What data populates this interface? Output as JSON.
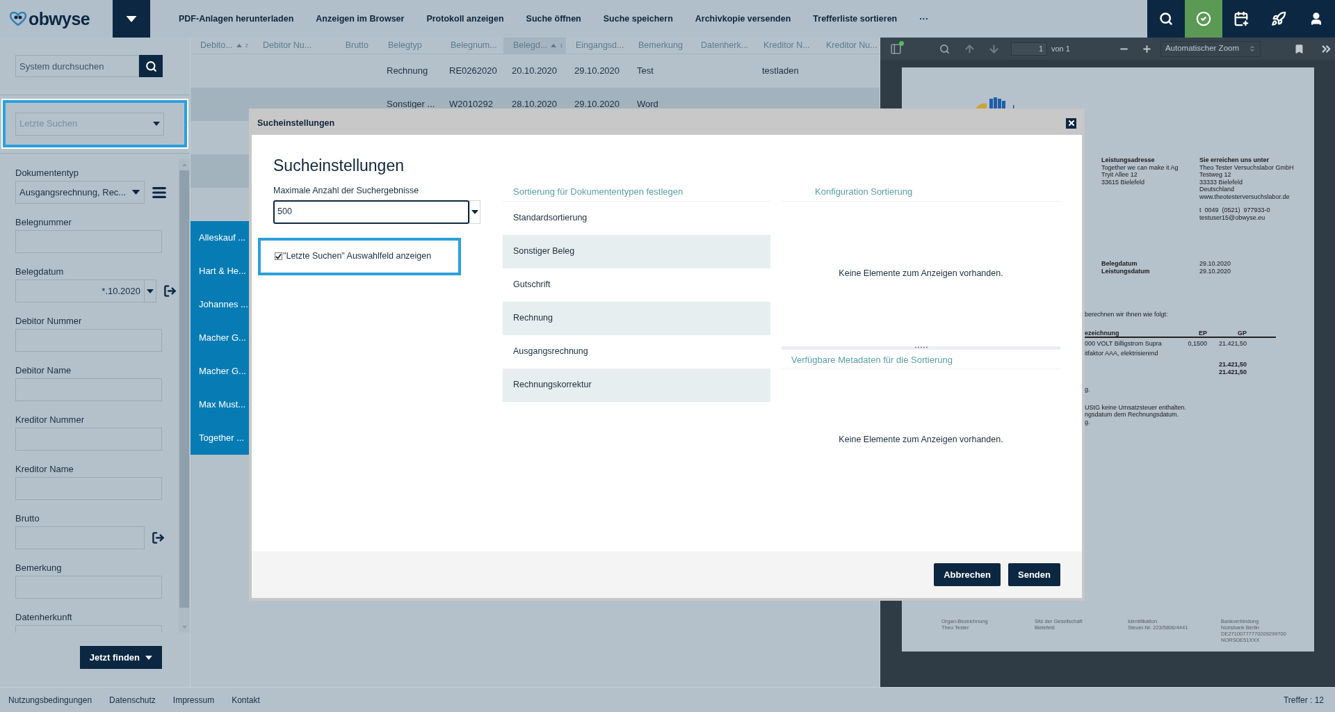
{
  "app": {
    "logo": "obwyse"
  },
  "toolbar": {
    "actions": [
      "PDF-Anlagen herunterladen",
      "Anzeigen im Browser",
      "Protokoll anzeigen",
      "Suche öffnen",
      "Suche speichern",
      "Archivkopie versenden",
      "Trefferliste sortieren"
    ],
    "more": "···"
  },
  "sidebar": {
    "search": {
      "placeholder": "System durchsuchen"
    },
    "recent": {
      "placeholder": "Letzte Suchen"
    },
    "fields": [
      {
        "label": "Dokumententyp",
        "kind": "select",
        "value": "Ausgangsrechnung, Rec..."
      },
      {
        "label": "Belegnummer",
        "kind": "text"
      },
      {
        "label": "Belegdatum",
        "kind": "date",
        "value": "*.10.2020"
      },
      {
        "label": "Debitor Nummer",
        "kind": "text"
      },
      {
        "label": "Debitor Name",
        "kind": "text"
      },
      {
        "label": "Kreditor Nummer",
        "kind": "text"
      },
      {
        "label": "Kreditor Name",
        "kind": "text"
      },
      {
        "label": "Brutto",
        "kind": "range"
      },
      {
        "label": "Bemerkung",
        "kind": "text"
      },
      {
        "label": "Datenherkunft",
        "kind": "text"
      }
    ],
    "submit": "Jetzt finden"
  },
  "table": {
    "columns": [
      {
        "label": "Debito...",
        "sort_order": "2",
        "active": false
      },
      {
        "label": "Debitor Nu...",
        "active": false
      },
      {
        "label": "Brutto",
        "active": false
      },
      {
        "label": "Belegtyp",
        "active": false
      },
      {
        "label": "Belegnum...",
        "active": false
      },
      {
        "label": "Belegd...",
        "sort_order": "1",
        "active": true
      },
      {
        "label": "Eingangsd...",
        "active": false
      },
      {
        "label": "Bemerkung",
        "active": false
      },
      {
        "label": "Datenherk...",
        "active": false
      },
      {
        "label": "Kreditor N...",
        "active": false
      },
      {
        "label": "Kreditor Nu...",
        "active": false
      }
    ],
    "rows": [
      {
        "belegtyp": "Rechnung",
        "belegnummer": "RE0262020",
        "belegdatum": "20.10.2020",
        "eingangsdatum": "29.10.2020",
        "bemerkung": "Test",
        "kreditor_name": "testladen"
      },
      {
        "belegtyp": "Sonstiger ...",
        "belegnummer": "W2010292",
        "belegdatum": "28.10.2020",
        "eingangsdatum": "29.10.2020",
        "bemerkung": "Word"
      },
      {},
      {},
      {},
      {
        "debitor": "Alleskauf ..."
      },
      {
        "debitor": "Hart & He..."
      },
      {
        "debitor": "Johannes ..."
      },
      {
        "debitor": "Macher G..."
      },
      {
        "debitor": "Macher G..."
      },
      {
        "debitor": "Max Must..."
      },
      {
        "debitor": "Together ..."
      }
    ]
  },
  "pdf_viewer": {
    "page_input": "1",
    "page_total": "von 1",
    "zoom": "Automatischer Zoom",
    "document": {
      "address_blocks": [
        {
          "heading": "Leistungsadresse",
          "lines": [
            "Together we can make it Ag",
            "Tryit Allee 12",
            "33615 Bielefeld"
          ]
        },
        {
          "heading": "Sie erreichen uns unter",
          "lines": [
            "Theo Tester Versuchslabor GmbH",
            "Testweg 12",
            "33333 Bielefeld",
            "Deutschland",
            "www.theotesterversuchslabor.de"
          ],
          "contact": [
            "t  0049  (0521)  977933-0",
            "testuser15@obwyse.eu"
          ]
        }
      ],
      "dates": [
        {
          "label": "Belegdatum",
          "value": "29.10.2020"
        },
        {
          "label": "Leistungsdatum",
          "value": "29.10.2020"
        }
      ],
      "intro": "berechnen wir Ihnen wie folgt:",
      "items": {
        "columns": [
          "ezeichnung",
          "EP",
          "GP"
        ],
        "rows": [
          [
            "000 VOLT Billigstrom Supra",
            "0,1500",
            "21.421,50"
          ],
          [
            "itfaktor AAA, elektrisierend"
          ]
        ],
        "totals": [
          "21.421,50",
          "21.421,50"
        ]
      },
      "notes": [
        [
          "g."
        ],
        [
          "UStG keine Umsatzsteuer enthalten.",
          "ngsdatum dem Rechnungsdatum.",
          "g."
        ]
      ],
      "footer": [
        [
          "Organ-Bezeichnung",
          "Theo Tester"
        ],
        [
          "Sitz der Gesellschaft",
          "Bielefeld"
        ],
        [
          "Identifikation",
          "Steuer-Nr. 223/5806/4441"
        ],
        [
          "Bankverbindung",
          "Norisbank Berlin",
          "DE27100777770209299700",
          "NORSDE51XXX"
        ]
      ]
    }
  },
  "dialog": {
    "title": "Sucheinstellungen",
    "heading": "Sucheinstellungen",
    "max_results": {
      "label": "Maximale Anzahl der Suchergebnisse",
      "value": "500"
    },
    "show_recent": {
      "label": "\"Letzte Suchen\" Auswahlfeld anzeigen",
      "checked": true
    },
    "doc_types": {
      "heading": "Sortierung für Dokumententypen festlegen",
      "items": [
        "Standardsortierung",
        "Sonstiger Beleg",
        "Gutschrift",
        "Rechnung",
        "Ausgangsrechnung",
        "Rechnungskorrektur"
      ]
    },
    "config": {
      "heading": "Konfiguration Sortierung",
      "empty": "Keine Elemente zum Anzeigen vorhanden."
    },
    "metadata": {
      "heading": "Verfügbare Metadaten für die Sortierung",
      "empty": "Keine Elemente zum Anzeigen vorhanden."
    },
    "buttons": [
      "Abbrechen",
      "Senden"
    ]
  },
  "footer": {
    "links": [
      "Nutzungsbedingungen",
      "Datenschutz",
      "Impressum",
      "Kontakt"
    ],
    "hits": "Treffer : 12"
  }
}
